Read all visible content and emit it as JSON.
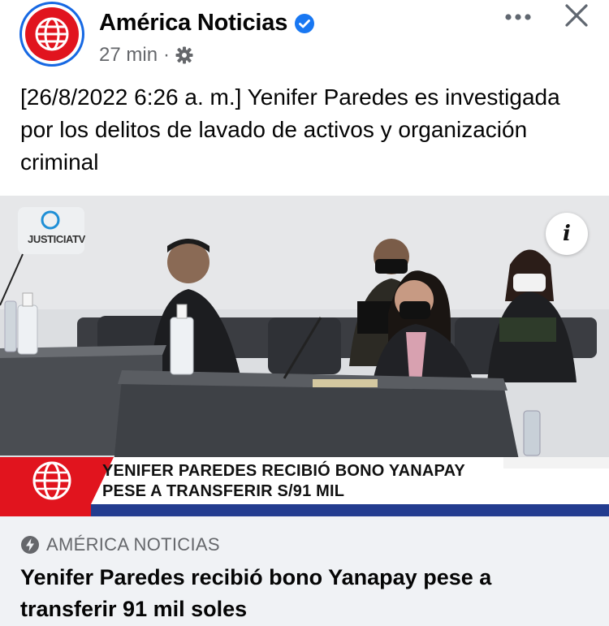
{
  "header": {
    "page_name": "América Noticias",
    "time_ago": "27 min",
    "separator": "·",
    "verified_icon": "verified-badge-icon",
    "audience_icon": "gear-icon",
    "more_icon": "more-dots-icon",
    "close_icon": "close-icon"
  },
  "post": {
    "text": "[26/8/2022 6:26 a. m.] Yenifer Paredes es investigada por los delitos de lavado de activos y organización criminal"
  },
  "media": {
    "watermark": "JUSTICIATV",
    "ticker_line1": "YENIFER PAREDES RECIBIÓ BONO YANAPAY",
    "ticker_line2": "PESE A TRANSFERIR S/91 MIL",
    "info_label": "i"
  },
  "link_preview": {
    "source_icon": "instant-article-bolt-icon",
    "source": "AMÉRICA NOTICIAS",
    "title": "Yenifer Paredes recibió bono Yanapay pese a transferir 91 mil soles"
  },
  "colors": {
    "brand_red": "#e1141e",
    "verified_blue": "#1877f2",
    "secondary_text": "#65676b",
    "preview_bg": "#f0f2f5"
  }
}
